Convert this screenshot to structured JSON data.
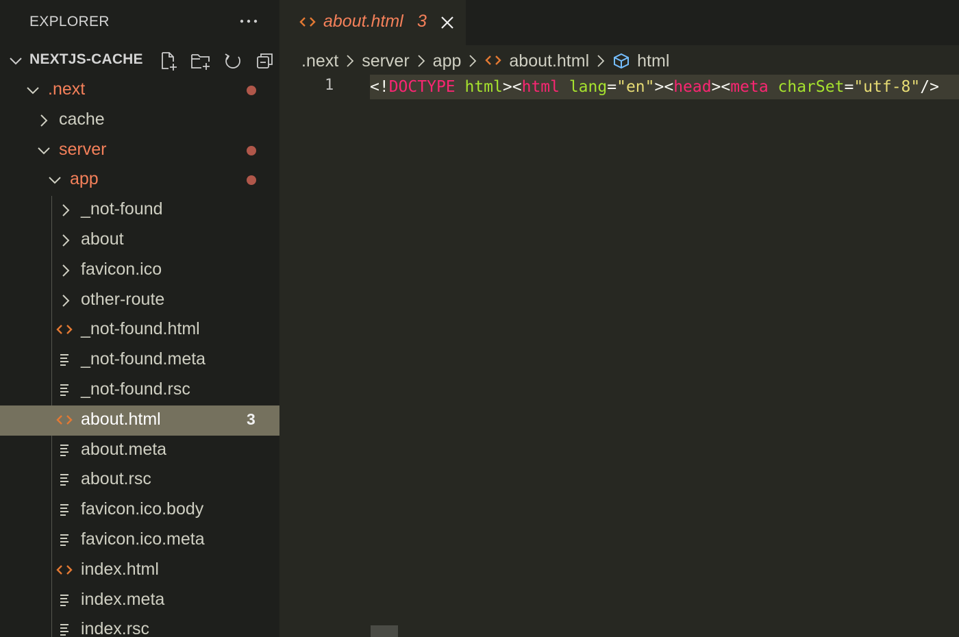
{
  "sidebar": {
    "title": "EXPLORER",
    "section_title": "NEXTJS-CACHE",
    "items": [
      {
        "label": ".next",
        "kind": "folder",
        "expanded": true,
        "modified": true,
        "dot": true
      },
      {
        "label": "cache",
        "kind": "folder",
        "expanded": false,
        "modified": false
      },
      {
        "label": "server",
        "kind": "folder",
        "expanded": true,
        "modified": true,
        "dot": true
      },
      {
        "label": "app",
        "kind": "folder",
        "expanded": true,
        "modified": true,
        "dot": true
      },
      {
        "label": "_not-found",
        "kind": "folder",
        "expanded": false
      },
      {
        "label": "about",
        "kind": "folder",
        "expanded": false
      },
      {
        "label": "favicon.ico",
        "kind": "folder",
        "expanded": false
      },
      {
        "label": "other-route",
        "kind": "folder",
        "expanded": false
      },
      {
        "label": "_not-found.html",
        "kind": "html"
      },
      {
        "label": "_not-found.meta",
        "kind": "text"
      },
      {
        "label": "_not-found.rsc",
        "kind": "text"
      },
      {
        "label": "about.html",
        "kind": "html",
        "selected": true,
        "count": "3"
      },
      {
        "label": "about.meta",
        "kind": "text"
      },
      {
        "label": "about.rsc",
        "kind": "text"
      },
      {
        "label": "favicon.ico.body",
        "kind": "text"
      },
      {
        "label": "favicon.ico.meta",
        "kind": "text"
      },
      {
        "label": "index.html",
        "kind": "html"
      },
      {
        "label": "index.meta",
        "kind": "text"
      },
      {
        "label": "index.rsc",
        "kind": "text"
      }
    ]
  },
  "tab": {
    "label": "about.html",
    "count": "3"
  },
  "breadcrumbs": {
    "items": [
      ".next",
      "server",
      "app",
      "about.html",
      "html"
    ]
  },
  "editor": {
    "line_number": "1",
    "tokens": [
      {
        "text": "<!",
        "cls": "t-punc"
      },
      {
        "text": "DOCTYPE",
        "cls": "t-kw"
      },
      {
        "text": " html",
        "cls": "t-doc"
      },
      {
        "text": "><",
        "cls": "t-punc"
      },
      {
        "text": "html",
        "cls": "t-tag"
      },
      {
        "text": " lang",
        "cls": "t-attr"
      },
      {
        "text": "=",
        "cls": "t-punc"
      },
      {
        "text": "\"en\"",
        "cls": "t-str"
      },
      {
        "text": "><",
        "cls": "t-punc"
      },
      {
        "text": "head",
        "cls": "t-tag"
      },
      {
        "text": "><",
        "cls": "t-punc"
      },
      {
        "text": "meta",
        "cls": "t-tag"
      },
      {
        "text": " charSet",
        "cls": "t-attr"
      },
      {
        "text": "=",
        "cls": "t-punc"
      },
      {
        "text": "\"utf-8\"",
        "cls": "t-str"
      },
      {
        "text": "/>",
        "cls": "t-punc"
      }
    ]
  },
  "colors": {
    "modified": "#f4805a",
    "html_icon": "#e37933",
    "selected_bg": "#75715e",
    "dot": "#b0574a",
    "crumb_symbol": "#75beff"
  }
}
